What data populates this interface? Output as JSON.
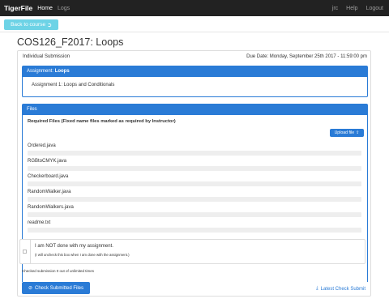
{
  "navbar": {
    "brand": "TigerFile",
    "links": [
      "Home",
      "Logs"
    ],
    "right": [
      "jrc",
      "Help",
      "Logout"
    ]
  },
  "back_button": {
    "label": "Back to course",
    "icon": "arrow-circle-icon"
  },
  "course_title": "COS126_F2017: Loops",
  "submission": {
    "type": "Individual Submission",
    "due": "Due Date: Monday, September 25th 2017 - 11:59:00 pm"
  },
  "assignment": {
    "header_prefix": "Assignment:",
    "header_name": "Loops",
    "description": "Assignment 1: Loops and Conditionals"
  },
  "files": {
    "header": "Files",
    "required_label": "Required Files (Fixed name files marked as required by Instructor)",
    "upload_label": "Upload file",
    "items": [
      "Ordered.java",
      "RGBtoCMYK.java",
      "Checkerboard.java",
      "RandomWalker.java",
      "RandomWalkers.java",
      "readme.txt"
    ]
  },
  "done_checkbox": {
    "label": "I am NOT done with my assignment.",
    "note": "(I will uncheck this box when I am done with the assignment.)"
  },
  "checked_submission": "Checked submission 0 out of unlimited times",
  "check_button": "Check Submitted Files",
  "latest_link": "Latest Check Submit",
  "colors": {
    "primary": "#2a7bd6",
    "navbar": "#222222",
    "back_button": "#6dd3e6"
  }
}
